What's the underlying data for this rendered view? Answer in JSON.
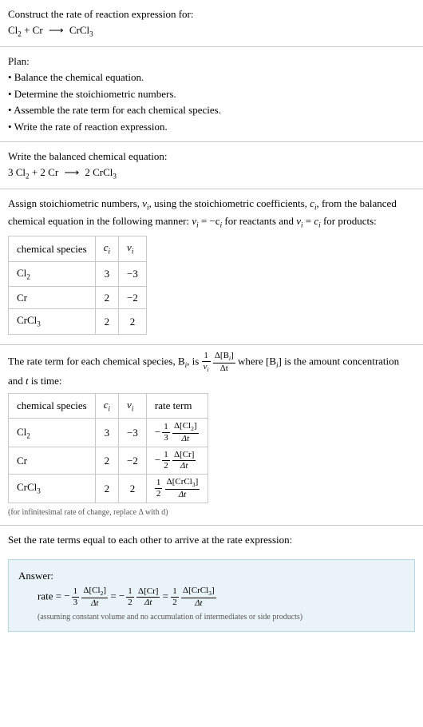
{
  "header": {
    "title": "Construct the rate of reaction expression for:",
    "eq_lhs1": "Cl",
    "eq_sub1": "2",
    "eq_plus": " + Cr ",
    "arrow": "⟶",
    "eq_rhs": " CrCl",
    "eq_sub2": "3"
  },
  "plan": {
    "title": "Plan:",
    "items": [
      "• Balance the chemical equation.",
      "• Determine the stoichiometric numbers.",
      "• Assemble the rate term for each chemical species.",
      "• Write the rate of reaction expression."
    ]
  },
  "balanced": {
    "title": "Write the balanced chemical equation:",
    "lhs": "3 Cl",
    "sub1": "2",
    "mid": " + 2 Cr ",
    "arrow": "⟶",
    "rhs": " 2 CrCl",
    "sub2": "3"
  },
  "stoich": {
    "intro1": "Assign stoichiometric numbers, ",
    "nu": "ν",
    "i": "i",
    "intro2": ", using the stoichiometric coefficients, ",
    "c": "c",
    "intro3": ", from the balanced chemical equation in the following manner: ",
    "eq1_lhs": "ν",
    "eq1_rhs": " = −c",
    "intro4": " for reactants and ",
    "eq2": " for products:",
    "headers": {
      "species": "chemical species",
      "ci": "c",
      "nui": "ν"
    },
    "rows": [
      {
        "species": "Cl",
        "sub": "2",
        "ci": "3",
        "nui": "−3"
      },
      {
        "species": "Cr",
        "sub": "",
        "ci": "2",
        "nui": "−2"
      },
      {
        "species": "CrCl",
        "sub": "3",
        "ci": "2",
        "nui": "2"
      }
    ]
  },
  "rateterm": {
    "intro1": "The rate term for each chemical species, B",
    "intro2": ", is ",
    "frac1_num": "1",
    "frac1_den_nu": "ν",
    "frac2_num_d": "Δ[B",
    "frac2_num_end": "]",
    "frac2_den": "Δt",
    "intro3": " where [B",
    "intro4": "] is the amount concentration and ",
    "t": "t",
    "intro5": " is time:",
    "headers": {
      "species": "chemical species",
      "ci": "c",
      "nui": "ν",
      "rate": "rate term"
    },
    "rows": [
      {
        "species": "Cl",
        "sub": "2",
        "ci": "3",
        "nui": "−3",
        "neg": "−",
        "fn": "1",
        "fd": "3",
        "conc": "Δ[Cl",
        "concsub": "2",
        "concend": "]",
        "dt": "Δt"
      },
      {
        "species": "Cr",
        "sub": "",
        "ci": "2",
        "nui": "−2",
        "neg": "−",
        "fn": "1",
        "fd": "2",
        "conc": "Δ[Cr]",
        "concsub": "",
        "concend": "",
        "dt": "Δt"
      },
      {
        "species": "CrCl",
        "sub": "3",
        "ci": "2",
        "nui": "2",
        "neg": "",
        "fn": "1",
        "fd": "2",
        "conc": "Δ[CrCl",
        "concsub": "3",
        "concend": "]",
        "dt": "Δt"
      }
    ],
    "note": "(for infinitesimal rate of change, replace Δ with d)"
  },
  "final": {
    "title": "Set the rate terms equal to each other to arrive at the rate expression:"
  },
  "answer": {
    "label": "Answer:",
    "rate": "rate = ",
    "neg": "−",
    "eq": " = ",
    "f1n": "1",
    "f1d": "3",
    "c1": "Δ[Cl",
    "c1s": "2",
    "c1e": "]",
    "f2n": "1",
    "f2d": "2",
    "c2": "Δ[Cr]",
    "f3n": "1",
    "f3d": "2",
    "c3": "Δ[CrCl",
    "c3s": "3",
    "c3e": "]",
    "dt": "Δt",
    "note": "(assuming constant volume and no accumulation of intermediates or side products)"
  }
}
